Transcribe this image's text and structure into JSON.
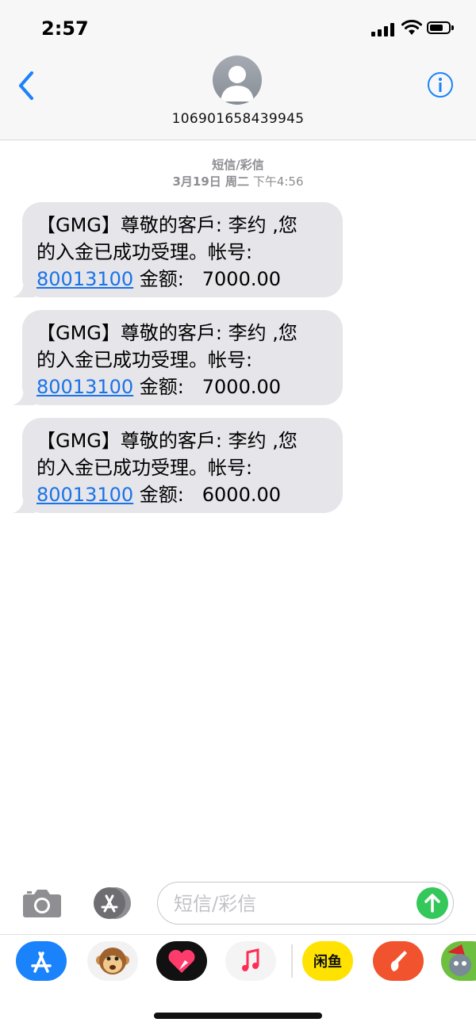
{
  "status_bar": {
    "time": "2:57"
  },
  "header": {
    "contact": "106901658439945"
  },
  "thread": {
    "type_label": "短信/彩信",
    "date": "3月19日 周二",
    "time": "下午4:56"
  },
  "messages": [
    {
      "line1": "【GMG】尊敬的客戶: 李约 ,您",
      "line2": "的入金已成功受理。帐号:",
      "account": "80013100",
      "amount_label": " 金额:",
      "amount": "7000.00"
    },
    {
      "line1": "【GMG】尊敬的客戶: 李约 ,您",
      "line2": "的入金已成功受理。帐号:",
      "account": "80013100",
      "amount_label": " 金额:",
      "amount": "7000.00"
    },
    {
      "line1": "【GMG】尊敬的客戶: 李约 ,您",
      "line2": "的入金已成功受理。帐号:",
      "account": "80013100",
      "amount_label": " 金额:",
      "amount": "6000.00"
    }
  ],
  "composer": {
    "placeholder": "短信/彩信"
  },
  "app_drawer": {
    "apps": [
      "app-store-icon",
      "animoji-icon",
      "digital-touch-icon",
      "music-icon",
      "xianyu-icon",
      "garageband-icon",
      "talking-tom-icon"
    ],
    "xianyu_label": "闲鱼"
  },
  "colors": {
    "accent": "#1a73e8",
    "send": "#34c759",
    "bubble": "#e5e5ea"
  }
}
